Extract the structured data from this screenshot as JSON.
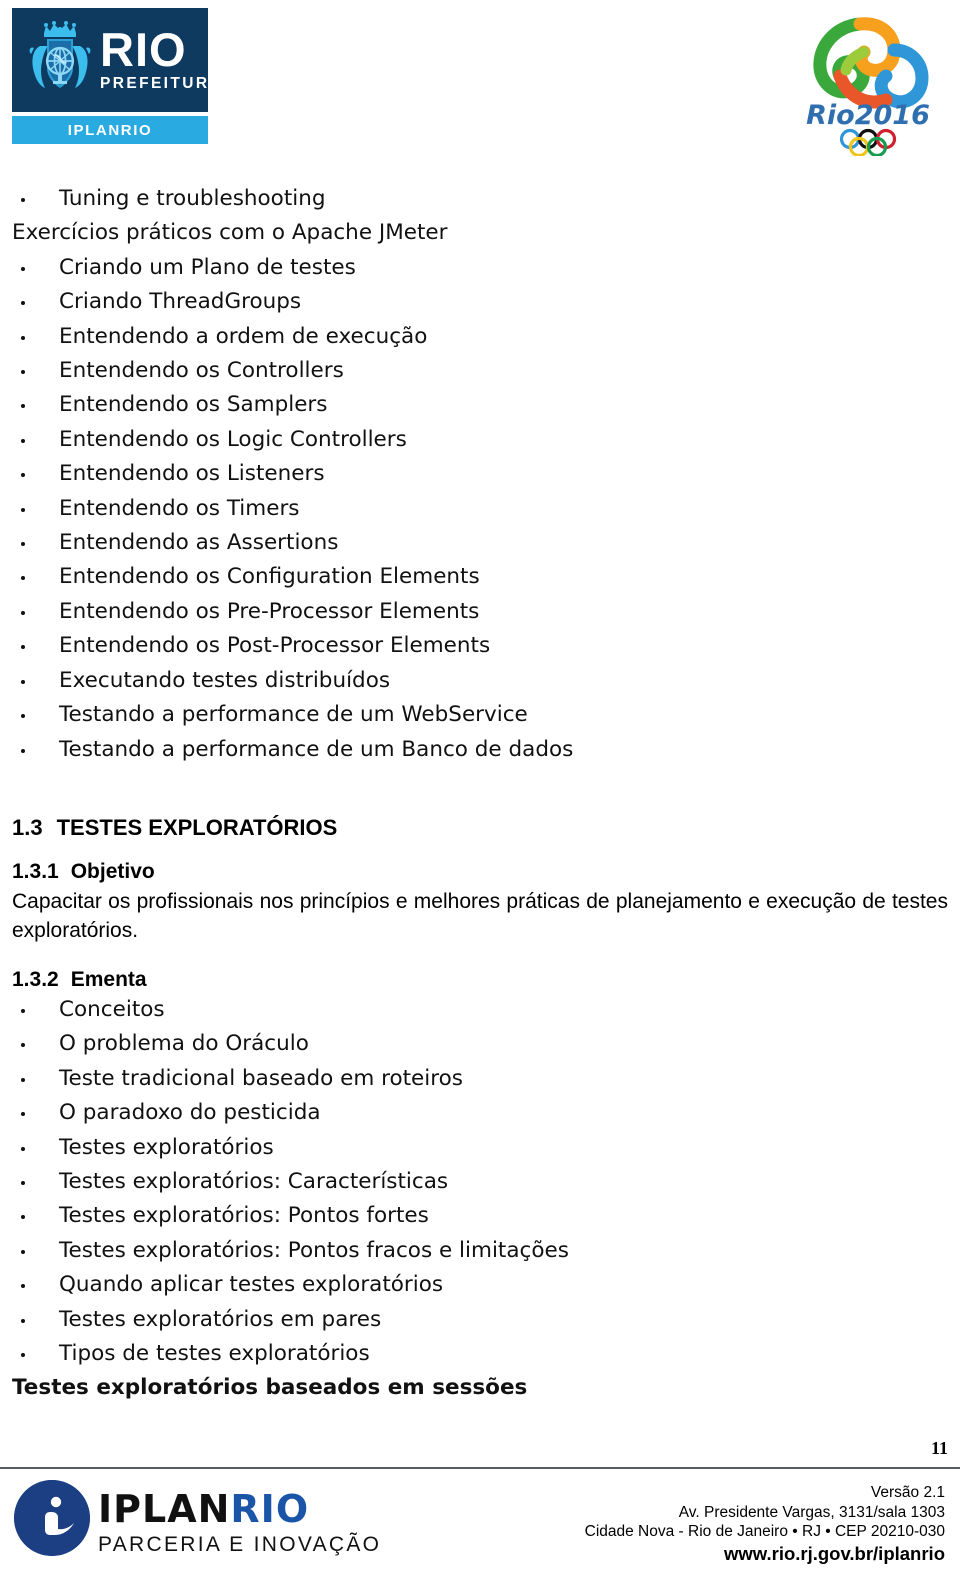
{
  "header": {
    "rio_logo": {
      "brand": "RIO",
      "sub_brand": "PREFEITURA",
      "unit": "IPLANRIO",
      "navy": "#0e3a5f",
      "cyan": "#29abe2"
    },
    "rio2016_logo": {
      "wordmark": "Rio2016",
      "alt": "Rio 2016 Olympic Games emblem"
    }
  },
  "content": {
    "jmeter_list": [
      {
        "text": "Tuning e troubleshooting",
        "bullet": true,
        "bold": false
      },
      {
        "text": "Exercícios práticos com o Apache JMeter",
        "bullet": false,
        "bold": false
      },
      {
        "text": "Criando um Plano de testes",
        "bullet": true,
        "bold": false
      },
      {
        "text": "Criando ThreadGroups",
        "bullet": true,
        "bold": false
      },
      {
        "text": "Entendendo a ordem de execução",
        "bullet": true,
        "bold": false
      },
      {
        "text": "Entendendo os Controllers",
        "bullet": true,
        "bold": false
      },
      {
        "text": "Entendendo os Samplers",
        "bullet": true,
        "bold": false
      },
      {
        "text": "Entendendo os Logic Controllers",
        "bullet": true,
        "bold": false
      },
      {
        "text": "Entendendo os Listeners",
        "bullet": true,
        "bold": false
      },
      {
        "text": "Entendendo os Timers",
        "bullet": true,
        "bold": false
      },
      {
        "text": "Entendendo as Assertions",
        "bullet": true,
        "bold": false
      },
      {
        "text": "Entendendo os Configuration Elements",
        "bullet": true,
        "bold": false
      },
      {
        "text": "Entendendo os Pre-Processor Elements",
        "bullet": true,
        "bold": false
      },
      {
        "text": "Entendendo os Post-Processor Elements",
        "bullet": true,
        "bold": false
      },
      {
        "text": "Executando testes distribuídos",
        "bullet": true,
        "bold": false
      },
      {
        "text": "Testando a performance de um WebService",
        "bullet": true,
        "bold": false
      },
      {
        "text": "Testando a performance de um Banco de dados",
        "bullet": true,
        "bold": false
      }
    ],
    "section": {
      "number": "1.3",
      "title": "TESTES EXPLORATÓRIOS"
    },
    "objetivo": {
      "number": "1.3.1",
      "title": "Objetivo",
      "paragraph": "Capacitar os profissionais nos princípios e melhores práticas de planejamento e execução de testes exploratórios."
    },
    "ementa": {
      "number": "1.3.2",
      "title": "Ementa",
      "items": [
        {
          "text": "Conceitos",
          "bullet": true,
          "bold": false
        },
        {
          "text": "O problema do Oráculo",
          "bullet": true,
          "bold": false
        },
        {
          "text": "Teste tradicional baseado em roteiros",
          "bullet": true,
          "bold": false
        },
        {
          "text": "O paradoxo do pesticida",
          "bullet": true,
          "bold": false
        },
        {
          "text": "Testes exploratórios",
          "bullet": true,
          "bold": false
        },
        {
          "text": "Testes exploratórios: Características",
          "bullet": true,
          "bold": false
        },
        {
          "text": "Testes exploratórios: Pontos fortes",
          "bullet": true,
          "bold": false
        },
        {
          "text": "Testes exploratórios: Pontos fracos e limitações",
          "bullet": true,
          "bold": false
        },
        {
          "text": "Quando aplicar testes exploratórios",
          "bullet": true,
          "bold": false
        },
        {
          "text": "Testes exploratórios em pares",
          "bullet": true,
          "bold": false
        },
        {
          "text": "Tipos de testes exploratórios",
          "bullet": true,
          "bold": false
        },
        {
          "text": "Testes exploratórios baseados em sessões",
          "bullet": false,
          "bold": true
        }
      ]
    }
  },
  "footer": {
    "page_number": "11",
    "iplan_logo": {
      "word_black": "IPLAN",
      "word_blue": "RIO",
      "tagline": "PARCERIA E INOVAÇÃO",
      "badge_letter": "i",
      "badge_color": "#1b3f82",
      "blue": "#1b55a8"
    },
    "address": {
      "version": "Versão 2.1",
      "street": "Av. Presidente Vargas, 3131/sala 1303",
      "city": "Cidade Nova - Rio de Janeiro • RJ • CEP 20210-030",
      "site": "www.rio.rj.gov.br/iplanrio"
    }
  }
}
